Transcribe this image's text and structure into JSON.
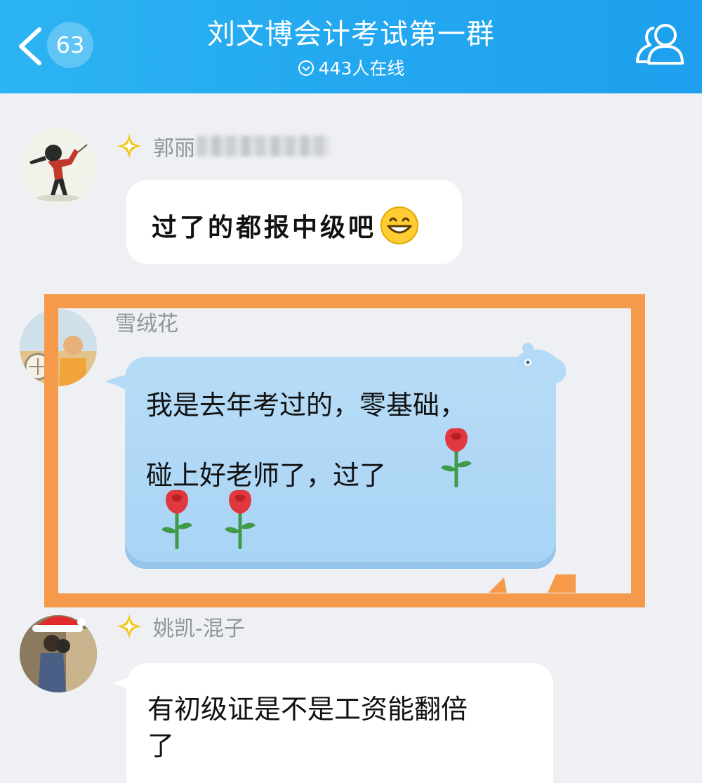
{
  "header": {
    "unread_count": "63",
    "title": "刘文博会计考试第一群",
    "online_text": "443人在线"
  },
  "messages": [
    {
      "sender": "郭丽",
      "text": "过了的都报中级吧",
      "emoji": "grinning-face",
      "has_rank_badge": true
    },
    {
      "sender": "雪绒花",
      "text_line1": "我是去年考过的，零基础，",
      "text_line2": "碰上好老师了，过了",
      "emoji": "rose",
      "rose_count": 3,
      "highlighted": true
    },
    {
      "sender": "姚凯-混子",
      "text_line1": "有初级证是不是工资能翻倍",
      "text_line2": "了",
      "has_rank_badge": true
    }
  ],
  "colors": {
    "header_blue": "#23a8f0",
    "highlight_orange": "#f49a4a",
    "bubble_blue": "#b7dcf7",
    "background": "#eef0f4"
  }
}
